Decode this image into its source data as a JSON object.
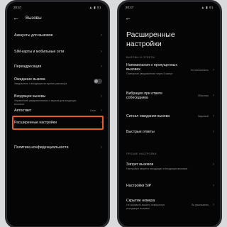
{
  "status_left": {
    "time": "20:47",
    "icons": "▲ ▮ 91"
  },
  "status_right": {
    "time": "20:47",
    "icons": "▲ ▮ 91"
  },
  "left_screen": {
    "title": "Вызовы",
    "items": [
      {
        "title": "Аккаунты для вызовов",
        "subtitle": ""
      },
      {
        "title": "SIM-карты и мобильные сети",
        "subtitle": ""
      },
      {
        "title": "Переадресация",
        "subtitle": ""
      },
      {
        "title": "Ожидание вызова",
        "subtitle": "Уведомлять о входящих во время разговора"
      },
      {
        "title": "Входящие вызовы",
        "subtitle": "Управление уведомлениями и звуком для входящих вызовов"
      },
      {
        "title": "Автоответ",
        "subtitle": "",
        "value": "Откл."
      },
      {
        "title": "Расширенные настройки",
        "subtitle": ""
      },
      {
        "title": "Политика конфиденциальности",
        "subtitle": ""
      }
    ]
  },
  "right_screen": {
    "title": "Расширенные настройки",
    "section_calls": "ВЫЗОВЫ И ОТВЕТЫ",
    "section_other": "ПРОЧИЕ НАСТРОЙКИ",
    "items_calls": [
      {
        "title": "Напоминания о пропущенных вызовах",
        "subtitle": "Повторное уведомление через 5 минут",
        "value": "Не напоминать"
      },
      {
        "title": "Вибрация при ответе собеседника",
        "subtitle": "",
        "value": "Обычная"
      },
      {
        "title": "Сигнал ожидания вызова",
        "subtitle": "",
        "value": "Звуковой"
      },
      {
        "title": "Быстрые ответы",
        "subtitle": "",
        "value": ""
      }
    ],
    "items_other": [
      {
        "title": "Запрет вызовов",
        "subtitle": "Настройки запрета исходящих и входящих вызовов"
      },
      {
        "title": "Настройки SIP",
        "subtitle": ""
      },
      {
        "title": "Скрытие номера",
        "subtitle": "Не скрывать вашего номера при исходящих вызовах",
        "value": "По умолчанию"
      }
    ]
  }
}
